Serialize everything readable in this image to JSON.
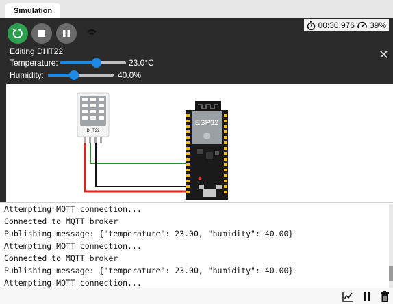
{
  "tabs": [
    {
      "label": "Simulation"
    }
  ],
  "toolbar": {
    "restart_icon": "restart-icon",
    "stop_icon": "stop-icon",
    "pause_icon": "pause-icon",
    "wifi_icon": "wifi-icon",
    "timer": "00:30.976",
    "speed": "39%"
  },
  "editor": {
    "title": "Editing DHT22",
    "temperature_label": "Temperature:",
    "temperature_value": "23.0°C",
    "temperature_fraction": 0.55,
    "humidity_label": "Humidity:",
    "humidity_value": "40.0%",
    "humidity_fraction": 0.4
  },
  "canvas": {
    "sensor_label": "DHT22",
    "board_label": "ESP32"
  },
  "console": {
    "lines": [
      "Attempting MQTT connection...",
      "Connected to MQTT broker",
      "Publishing message: {\"temperature\": 23.00, \"humidity\": 40.00}",
      "Attempting MQTT connection...",
      "Connected to MQTT broker",
      "Publishing message: {\"temperature\": 23.00, \"humidity\": 40.00}",
      "Attempting MQTT connection..."
    ]
  },
  "colors": {
    "restart": "#2e9e4f",
    "wire_red": "#d9261c",
    "wire_green": "#2e8b2e",
    "wire_black": "#111111",
    "slider": "#1e88e5"
  }
}
